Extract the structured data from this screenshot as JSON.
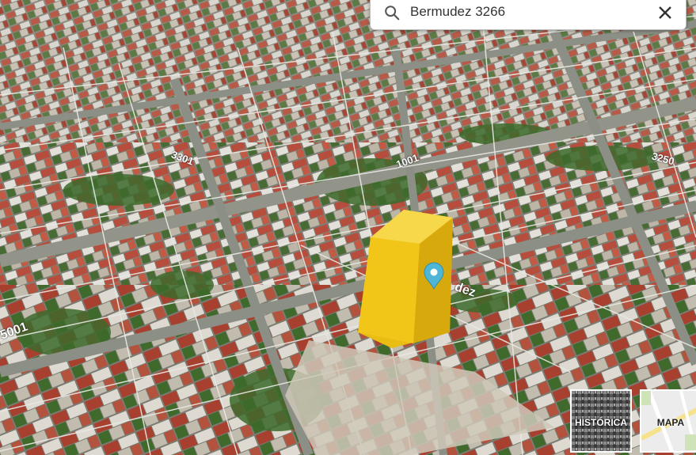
{
  "search": {
    "value": "Bermudez 3266"
  },
  "street_labels": [
    {
      "text": "3301"
    },
    {
      "text": "1001"
    },
    {
      "text": "3250"
    },
    {
      "text": "dez"
    },
    {
      "text": "5001"
    }
  ],
  "layers": {
    "historica_label": "HISTÓRICA",
    "mapa_label": "MAPA"
  },
  "colors": {
    "building_highlight": "#f2c71b",
    "pin": "#4fb6d6",
    "roof_red": "#b84a3c",
    "vegetation": "#3f6b2f"
  },
  "icons": [
    "search-icon",
    "close-icon",
    "map-pin-icon"
  ]
}
